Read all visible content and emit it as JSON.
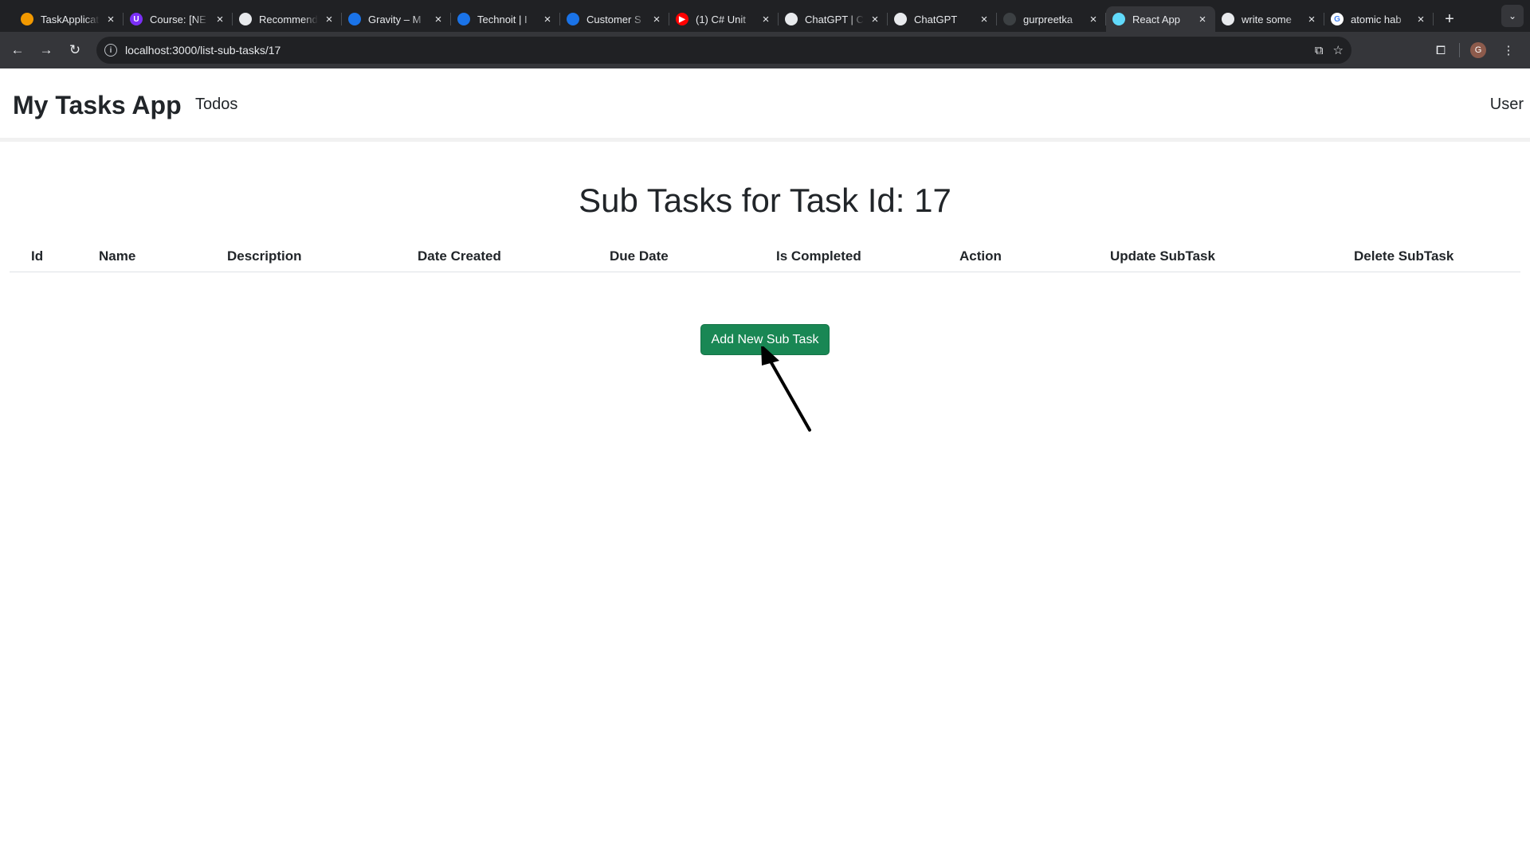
{
  "browser": {
    "tabs": [
      {
        "title": "TaskApplication",
        "color": "#f29900",
        "glyph": "",
        "active": false
      },
      {
        "title": "Course: [NE",
        "color": "#7b2ff7",
        "glyph": "U",
        "active": false
      },
      {
        "title": "Recommend",
        "color": "#e8eaed",
        "glyph": "",
        "active": false
      },
      {
        "title": "Gravity – M",
        "color": "#1a73e8",
        "glyph": "",
        "active": false
      },
      {
        "title": "Technoit | I",
        "color": "#1a73e8",
        "glyph": "",
        "active": false
      },
      {
        "title": "Customer S",
        "color": "#1a73e8",
        "glyph": "",
        "active": false
      },
      {
        "title": "(1) C# Unit",
        "color": "#ff0000",
        "glyph": "▶",
        "active": false
      },
      {
        "title": "ChatGPT | C",
        "color": "#e8eaed",
        "glyph": "",
        "active": false
      },
      {
        "title": "ChatGPT",
        "color": "#e8eaed",
        "glyph": "",
        "active": false
      },
      {
        "title": "gurpreetka",
        "color": "#3c4043",
        "glyph": "",
        "active": false
      },
      {
        "title": "React App",
        "color": "#61dafb",
        "glyph": "",
        "active": true
      },
      {
        "title": "write some",
        "color": "#e8eaed",
        "glyph": "",
        "active": false
      },
      {
        "title": "atomic hab",
        "color": "#ffffff",
        "glyph": "G",
        "active": false
      }
    ],
    "url": "localhost:3000/list-sub-tasks/17",
    "avatar_initial": "G"
  },
  "app": {
    "brand": "My Tasks App",
    "nav_todos": "Todos",
    "nav_user": "User"
  },
  "main": {
    "heading": "Sub Tasks for Task Id: 17",
    "table_headers": [
      "Id",
      "Name",
      "Description",
      "Date Created",
      "Due Date",
      "Is Completed",
      "Action",
      "Update SubTask",
      "Delete SubTask"
    ],
    "add_button_label": "Add New Sub Task",
    "add_button_color": "#198754"
  }
}
